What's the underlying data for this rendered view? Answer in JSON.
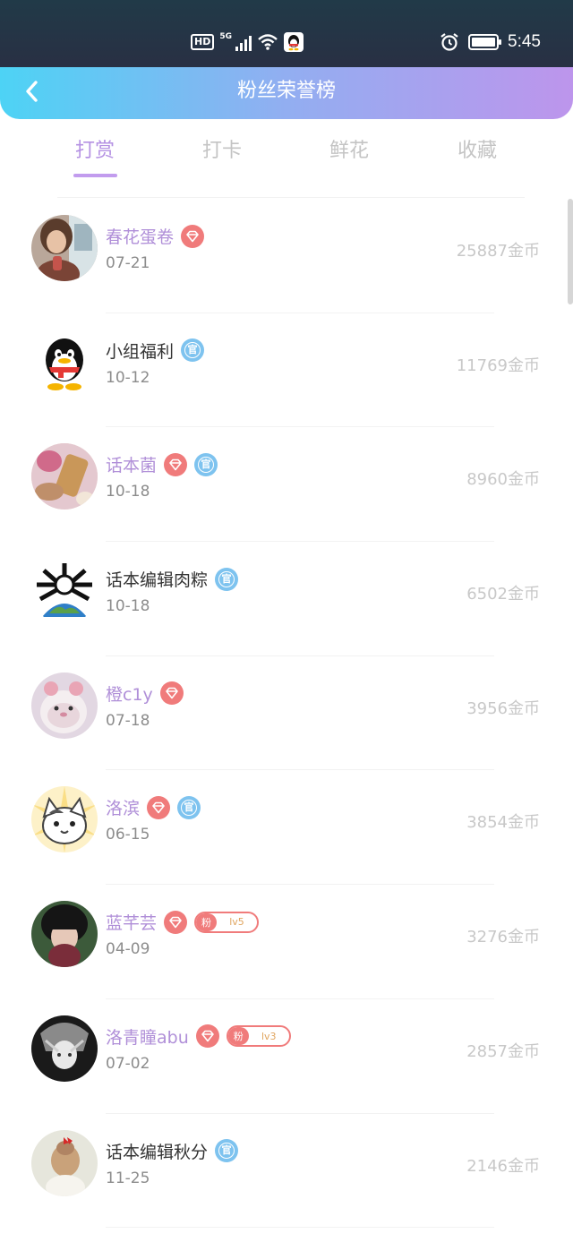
{
  "status_bar": {
    "hd": "HD",
    "network": "5G",
    "time": "5:45",
    "icons": [
      "hd-icon",
      "signal-icon",
      "wifi-icon",
      "qq-notification-icon",
      "alarm-icon",
      "battery-icon"
    ]
  },
  "header": {
    "title": "粉丝荣誉榜",
    "back_icon": "chevron-left-icon"
  },
  "tabs": [
    {
      "label": "打赏",
      "active": true
    },
    {
      "label": "打卡",
      "active": false
    },
    {
      "label": "鲜花",
      "active": false
    },
    {
      "label": "收藏",
      "active": false
    }
  ],
  "fans": [
    {
      "name": "春花蛋卷",
      "date": "07-21",
      "amount": "25887金币",
      "vip": true,
      "official": false,
      "fan_level": null,
      "highlight": true
    },
    {
      "name": "小组福利",
      "date": "10-12",
      "amount": "11769金币",
      "vip": false,
      "official": true,
      "fan_level": null,
      "highlight": false
    },
    {
      "name": "话本菌",
      "date": "10-18",
      "amount": "8960金币",
      "vip": true,
      "official": true,
      "fan_level": null,
      "highlight": true
    },
    {
      "name": "话本编辑肉粽",
      "date": "10-18",
      "amount": "6502金币",
      "vip": false,
      "official": true,
      "fan_level": null,
      "highlight": false
    },
    {
      "name": "橙c1y",
      "date": "07-18",
      "amount": "3956金币",
      "vip": true,
      "official": false,
      "fan_level": null,
      "highlight": true
    },
    {
      "name": "洛滨",
      "date": "06-15",
      "amount": "3854金币",
      "vip": true,
      "official": true,
      "fan_level": null,
      "highlight": true
    },
    {
      "name": "蓝芊芸",
      "date": "04-09",
      "amount": "3276金币",
      "vip": true,
      "official": false,
      "fan_level": "lv5",
      "highlight": true
    },
    {
      "name": "洛青瞳abu",
      "date": "07-02",
      "amount": "2857金币",
      "vip": true,
      "official": false,
      "fan_level": "lv3",
      "highlight": true
    },
    {
      "name": "话本编辑秋分",
      "date": "11-25",
      "amount": "2146金币",
      "vip": false,
      "official": true,
      "fan_level": null,
      "highlight": false
    }
  ],
  "badges": {
    "official": "官",
    "fan": "粉"
  },
  "colors": {
    "accent": "#b592e3",
    "header_start": "#4dd3f5",
    "header_end": "#bd95ec",
    "vip": "#f07b7b",
    "official": "#7ec3ef"
  }
}
